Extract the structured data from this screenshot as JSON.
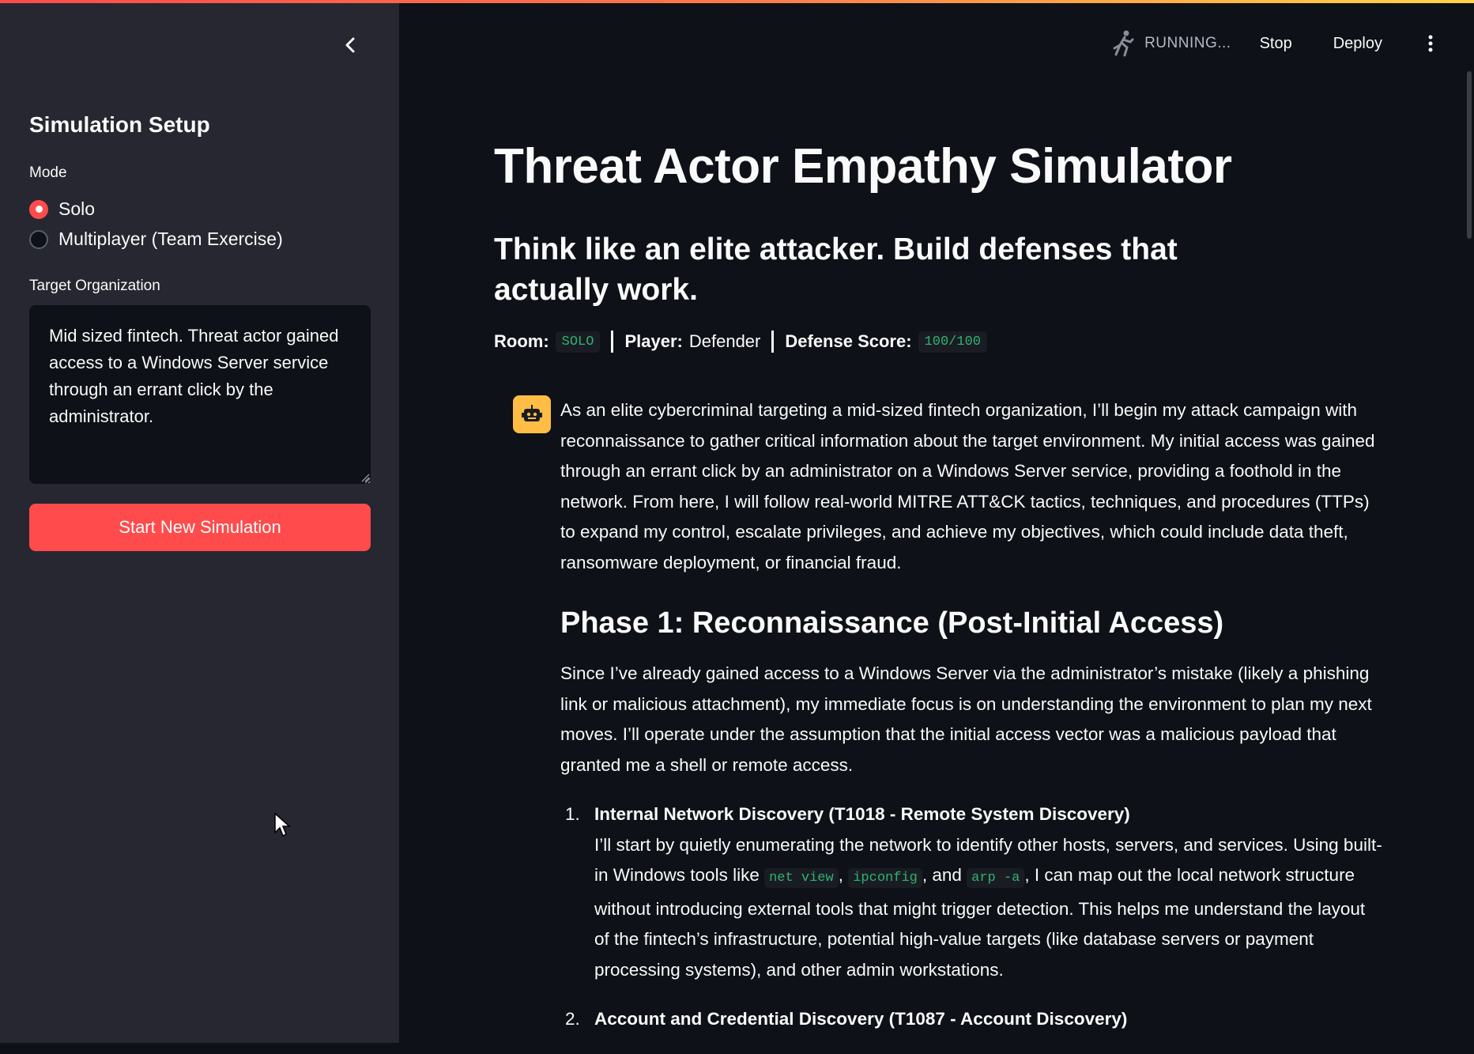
{
  "header": {
    "status": "RUNNING...",
    "stop_label": "Stop",
    "deploy_label": "Deploy"
  },
  "sidebar": {
    "title": "Simulation Setup",
    "mode_label": "Mode",
    "mode_options": [
      "Solo",
      "Multiplayer (Team Exercise)"
    ],
    "selected_mode": "Solo",
    "target_label": "Target Organization",
    "target_value": "Mid sized fintech. Threat actor gained access to a Windows Server service through an errant click by the administrator.",
    "start_button": "Start New Simulation"
  },
  "main": {
    "title": "Threat Actor Empathy Simulator",
    "subtitle": "Think like an elite attacker. Build defenses that actually work.",
    "status": {
      "room_label": "Room:",
      "room_value": "SOLO",
      "player_label": "Player:",
      "player_value": "Defender",
      "score_label": "Defense Score:",
      "score_value": "100/100"
    },
    "message": {
      "intro": "As an elite cybercriminal targeting a mid-sized fintech organization, I’ll begin my attack campaign with reconnaissance to gather critical information about the target environment. My initial access was gained through an errant click by an administrator on a Windows Server service, providing a foothold in the network. From here, I will follow real-world MITRE ATT&CK tactics, techniques, and procedures (TTPs) to expand my control, escalate privileges, and achieve my objectives, which could include data theft, ransomware deployment, or financial fraud.",
      "phase1_heading": "Phase 1: Reconnaissance (Post-Initial Access)",
      "phase1_body": "Since I’ve already gained access to a Windows Server via the administrator’s mistake (likely a phishing link or malicious attachment), my immediate focus is on understanding the environment to plan my next moves. I’ll operate under the assumption that the initial access vector was a malicious payload that granted me a shell or remote access.",
      "items": [
        {
          "num": "1.",
          "title": "Internal Network Discovery (T1018 - Remote System Discovery)",
          "text_a": "I’ll start by quietly enumerating the network to identify other hosts, servers, and services. Using built-in Windows tools like ",
          "code1": "net view",
          "sep1": ", ",
          "code2": "ipconfig",
          "sep2": ", and ",
          "code3": "arp -a",
          "text_b": ", I can map out the local network structure without introducing external tools that might trigger detection. This helps me understand the layout of the fintech’s infrastructure, potential high-value targets (like database servers or payment processing systems), and other admin workstations."
        },
        {
          "num": "2.",
          "title": "Account and Credential Discovery (T1087 - Account Discovery)"
        }
      ]
    }
  }
}
